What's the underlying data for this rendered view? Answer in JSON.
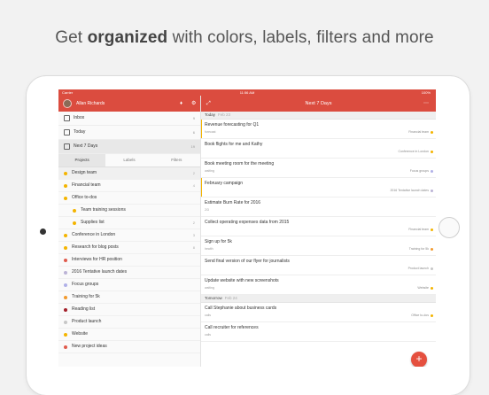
{
  "headline": {
    "pre": "Get ",
    "bold": "organized",
    "post": " with colors, labels, filters and more"
  },
  "statusbar": {
    "carrier": "Carrier",
    "time": "11:56 AM",
    "battery": "100%"
  },
  "sidebar": {
    "user": "Allan Richards",
    "nav": [
      {
        "label": "Inbox",
        "count": "9"
      },
      {
        "label": "Today",
        "count": "6"
      },
      {
        "label": "Next 7 Days",
        "count": "19"
      }
    ],
    "tabs": [
      "Projects",
      "Labels",
      "Filters"
    ],
    "projects": [
      {
        "label": "Design team",
        "count": "2",
        "color": "#f4b400",
        "indent": 0,
        "sel": true
      },
      {
        "label": "Financial team",
        "count": "4",
        "color": "#f4b400",
        "indent": 0
      },
      {
        "label": "Office to-dos",
        "count": "",
        "color": "#f4b400",
        "indent": 0
      },
      {
        "label": "Team training sessions",
        "count": "",
        "color": "#f4b400",
        "indent": 1
      },
      {
        "label": "Supplies list",
        "count": "2",
        "color": "#f4b400",
        "indent": 1
      },
      {
        "label": "Conference in London",
        "count": "3",
        "color": "#f4b400",
        "indent": 0
      },
      {
        "label": "Research for blog posts",
        "count": "8",
        "color": "#f4b400",
        "indent": 0
      },
      {
        "label": "Interviews for HR position",
        "count": "",
        "color": "#e05b4d",
        "indent": 0
      },
      {
        "label": "2016 Tentative launch dates",
        "count": "",
        "color": "#bbb3d6",
        "indent": 0
      },
      {
        "label": "Focus groups",
        "count": "",
        "color": "#b0b0e8",
        "indent": 0
      },
      {
        "label": "Training for 5k",
        "count": "",
        "color": "#f29a2e",
        "indent": 0
      },
      {
        "label": "Reading list",
        "count": "",
        "color": "#a3202a",
        "indent": 0
      },
      {
        "label": "Product launch",
        "count": "",
        "color": "#c7c7c7",
        "indent": 0
      },
      {
        "label": "Website",
        "count": "",
        "color": "#f4b400",
        "indent": 0
      },
      {
        "label": "New project ideas",
        "count": "",
        "color": "#e05b4d",
        "indent": 0
      }
    ]
  },
  "main": {
    "title": "Next 7 Days",
    "sections": [
      {
        "name": "Today",
        "date": "Feb 23",
        "tasks": [
          {
            "title": "Revenue forecasting for Q1",
            "sub": "forecast",
            "project": "Financial team",
            "color": "#f4b400",
            "bar": "#f4b400"
          },
          {
            "title": "Book flights for me and Kathy",
            "sub": "",
            "project": "Conference in London",
            "color": "#f4b400",
            "bar": ""
          },
          {
            "title": "Book meeting room for the meeting",
            "sub": "waiting",
            "project": "Focus groups",
            "color": "#b0b0e8",
            "bar": ""
          },
          {
            "title": "February campaign",
            "sub": "",
            "project": "2016 Tentative launch dates",
            "color": "#bbb3d6",
            "bar": "#f4b400"
          },
          {
            "title": "Estimate Burn Rate for 2016",
            "sub": "2/3",
            "project": "",
            "color": "",
            "bar": ""
          },
          {
            "title": "Collect operating expenses data from 2015",
            "sub": "",
            "project": "Financial team",
            "color": "#f4b400",
            "bar": ""
          },
          {
            "title": "Sign up for 5k",
            "sub": "health",
            "project": "Training for 5k",
            "color": "#f29a2e",
            "bar": ""
          },
          {
            "title": "Send final version of our flyer for journalists",
            "sub": "",
            "project": "Product launch",
            "color": "#c7c7c7",
            "bar": ""
          },
          {
            "title": "Update website with new screenshots",
            "sub": "waiting",
            "project": "Website",
            "color": "#f4b400",
            "bar": ""
          }
        ]
      },
      {
        "name": "Tomorrow",
        "date": "Feb 24",
        "tasks": [
          {
            "title": "Call Stephanie about business cards",
            "sub": "calls",
            "project": "Office to-dos",
            "color": "#f4b400",
            "bar": ""
          },
          {
            "title": "Call recruiter for references",
            "sub": "calls",
            "project": "",
            "color": "",
            "bar": ""
          }
        ]
      }
    ],
    "fab": "+"
  }
}
